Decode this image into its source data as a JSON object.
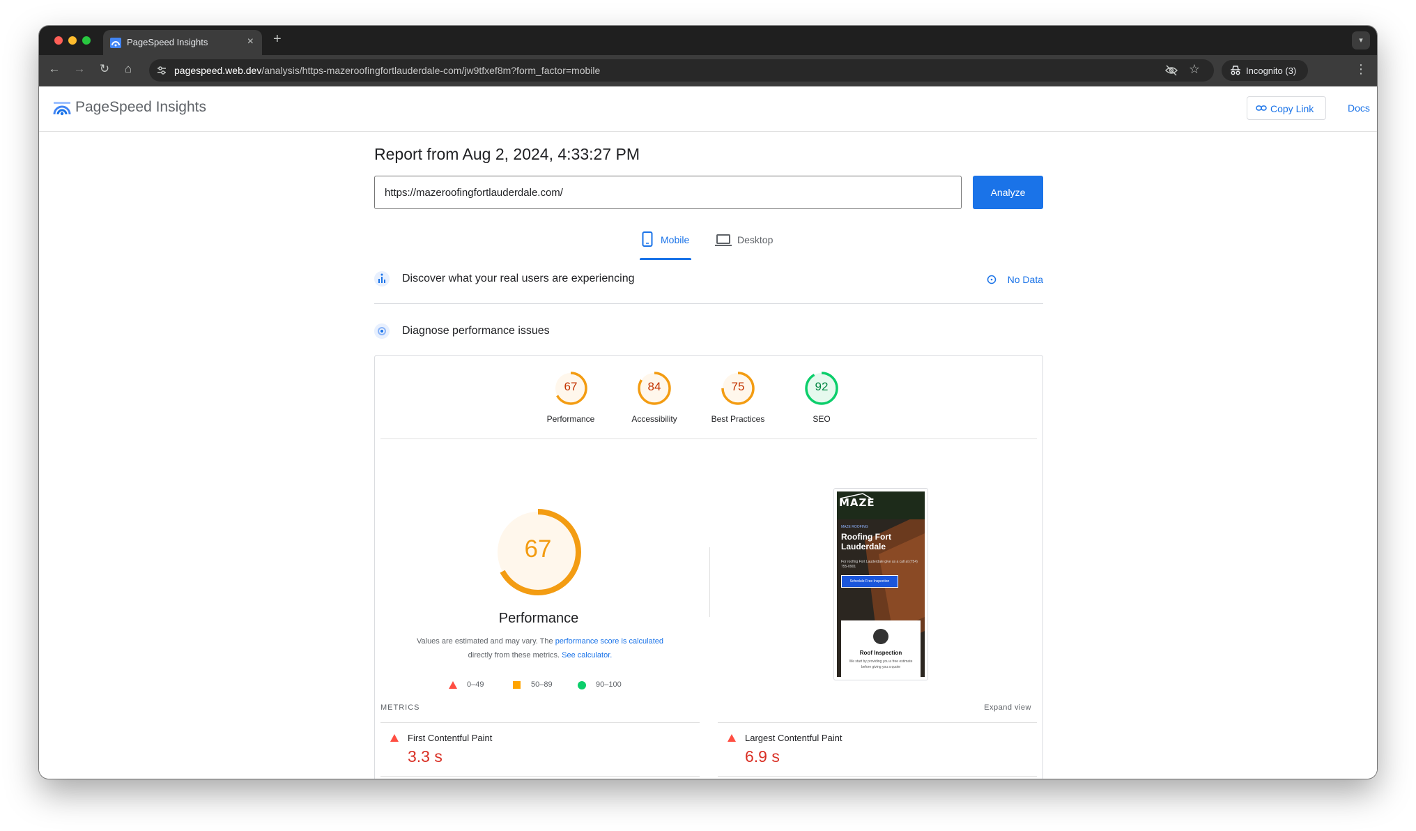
{
  "browser": {
    "tab_title": "PageSpeed Insights",
    "url_host": "pagespeed.web.dev",
    "url_path": "/analysis/https-mazeroofingfortlauderdale-com/jw9tfxef8m?form_factor=mobile",
    "incognito_label": "Incognito (3)"
  },
  "header": {
    "logo_text": "PageSpeed Insights",
    "copy_link_label": "Copy Link",
    "docs_label": "Docs"
  },
  "report": {
    "title": "Report from Aug 2, 2024, 4:33:27 PM",
    "url_value": "https://mazeroofingfortlauderdale.com/",
    "analyze_label": "Analyze"
  },
  "device_tabs": {
    "mobile_label": "Mobile",
    "desktop_label": "Desktop",
    "selected": "Mobile"
  },
  "field_data": {
    "title": "Discover what your real users are experiencing",
    "status_label": "No Data"
  },
  "lab": {
    "title": "Diagnose performance issues"
  },
  "scores": [
    {
      "label": "Performance",
      "value": 67,
      "color": "#f39c12"
    },
    {
      "label": "Accessibility",
      "value": 84,
      "color": "#f39c12"
    },
    {
      "label": "Best Practices",
      "value": 75,
      "color": "#f39c12"
    },
    {
      "label": "SEO",
      "value": 92,
      "color": "#0cce6b"
    }
  ],
  "score_text_colors": {
    "orange": "#c33300",
    "green": "#018642"
  },
  "performance": {
    "score": 67,
    "label": "Performance",
    "note_prefix": "Values are estimated and may vary. The ",
    "note_link1": "performance score is calculated",
    "note_middle": " directly from these metrics. ",
    "note_link2": "See calculator."
  },
  "legend": [
    {
      "range": "0–49",
      "color": "#ff4e42",
      "shape": "triangle"
    },
    {
      "range": "50–89",
      "color": "#ffa400",
      "shape": "square"
    },
    {
      "range": "90–100",
      "color": "#0cce6b",
      "shape": "circle"
    }
  ],
  "site_preview": {
    "logo": "MAZE",
    "tagline": "MAZE ROOFING",
    "heading": "Roofing Fort Lauderdale",
    "copy": "For roofing Fort Lauderdale give us a call at (754) 755-0901",
    "button": "Schedule Free Inspection",
    "card_title": "Roof Inspection",
    "card_copy": "We start by providing you a free estimate before giving you a quote"
  },
  "metrics": {
    "section_label": "METRICS",
    "expand_label": "Expand view",
    "items": [
      {
        "name": "First Contentful Paint",
        "value": "3.3 s"
      },
      {
        "name": "Largest Contentful Paint",
        "value": "6.9 s"
      }
    ]
  }
}
